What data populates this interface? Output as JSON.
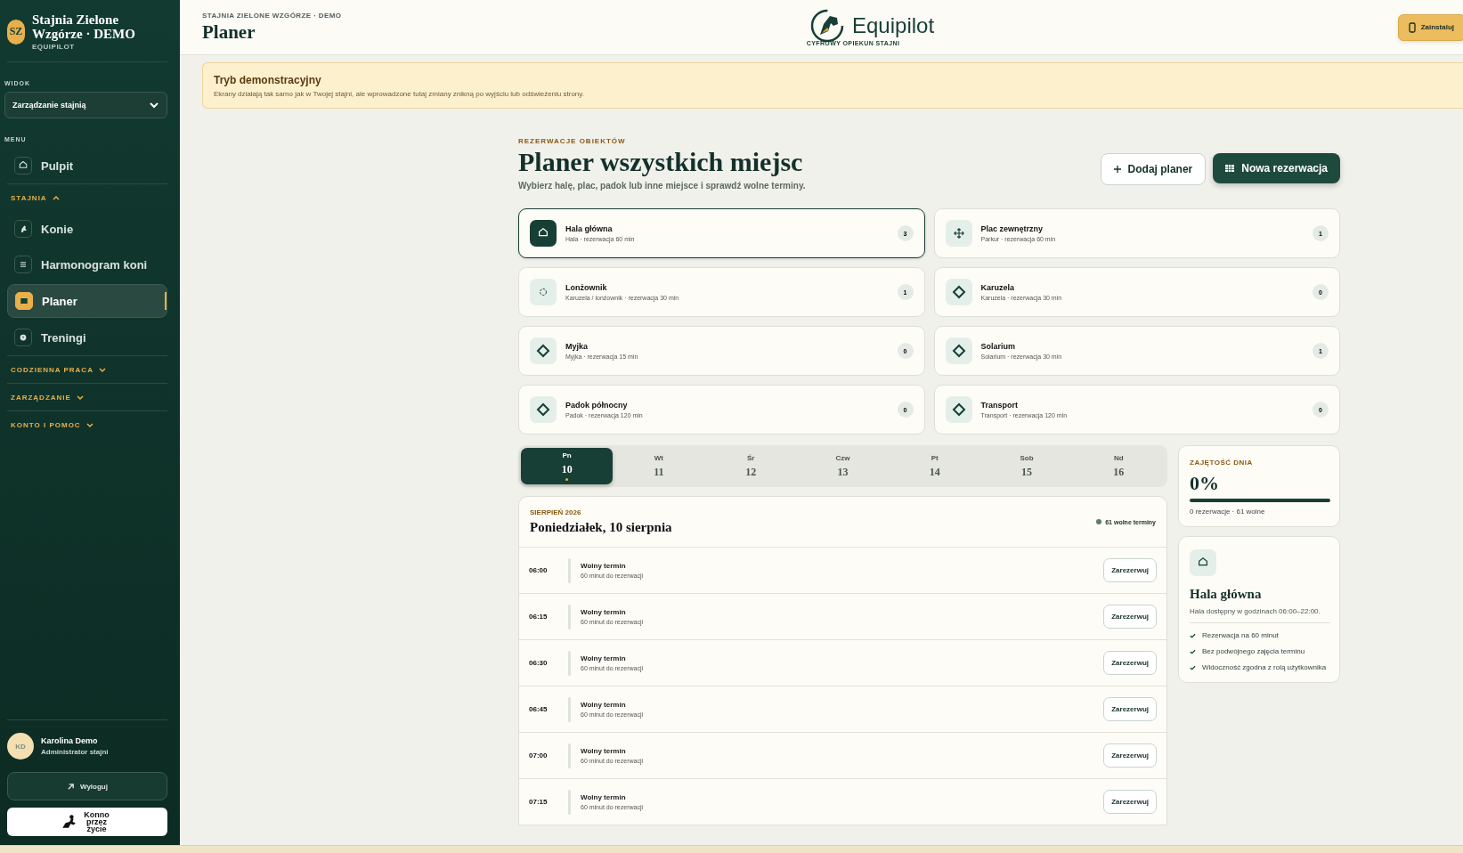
{
  "sidebar": {
    "initials": "SZ",
    "stable_name": "Stajnia Zielone Wzgórze · DEMO",
    "brand": "EQUIPILOT",
    "view_label": "WIDOK",
    "view_select": "Zarządzanie stajnią",
    "menu_label": "MENU",
    "menu": [
      {
        "kind": "link",
        "label": "Pulpit",
        "selected": false
      },
      {
        "kind": "group",
        "label": "STAJNIA",
        "expanded": true,
        "children": [
          {
            "kind": "link",
            "label": "Konie",
            "selected": false
          },
          {
            "kind": "link",
            "label": "Harmonogram koni",
            "selected": false
          },
          {
            "kind": "link",
            "label": "Planer",
            "selected": true
          },
          {
            "kind": "link",
            "label": "Treningi",
            "selected": false
          }
        ]
      },
      {
        "kind": "group",
        "label": "CODZIENNA PRACA",
        "expanded": false
      },
      {
        "kind": "group",
        "label": "ZARZĄDZANIE",
        "expanded": false
      },
      {
        "kind": "group",
        "label": "KONTO I POMOC",
        "expanded": false
      }
    ],
    "user": {
      "initials": "KD",
      "name": "Karolina Demo",
      "role": "Administrator stajni"
    },
    "logout": "Wyloguj",
    "partner": "Konno przez życie"
  },
  "header": {
    "breadcrumb": "STAJNIA ZIELONE WZGÓRZE · DEMO",
    "title": "Planer",
    "brand": "Equipilot",
    "tagline": "CYFROWY OPIEKUN STAJNI",
    "install": "Zainstaluj"
  },
  "banner": {
    "title": "Tryb demonstracyjny",
    "text": "Ekrany działają tak samo jak w Twojej stajni, ale wprowadzone tutaj zmiany znikną po wyjściu lub odświeżeniu strony."
  },
  "planner": {
    "eyebrow": "REZERWACJE OBIEKTÓW",
    "title": "Planer wszystkich miejsc",
    "subtitle": "Wybierz halę, plac, padok lub inne miejsce i sprawdź wolne terminy.",
    "add_button": "Dodaj planer",
    "new_button": "Nowa rezerwacja"
  },
  "facilities": [
    {
      "name": "Hala główna",
      "detail": "Hala · rezerwacja 60 min",
      "count": "3",
      "selected": true
    },
    {
      "name": "Plac zewnętrzny",
      "detail": "Parkur · rezerwacja 60 min",
      "count": "1",
      "selected": false
    },
    {
      "name": "Lonżownik",
      "detail": "Karuzela / lonżownik · rezerwacja 30 min",
      "count": "1",
      "selected": false
    },
    {
      "name": "Karuzela",
      "detail": "Karuzela · rezerwacja 30 min",
      "count": "0",
      "selected": false
    },
    {
      "name": "Myjka",
      "detail": "Myjka · rezerwacja 15 min",
      "count": "0",
      "selected": false
    },
    {
      "name": "Solarium",
      "detail": "Solarium · rezerwacja 30 min",
      "count": "1",
      "selected": false
    },
    {
      "name": "Padok północny",
      "detail": "Padok · rezerwacja 120 min",
      "count": "0",
      "selected": false
    },
    {
      "name": "Transport",
      "detail": "Transport · rezerwacja 120 min",
      "count": "0",
      "selected": false
    }
  ],
  "days": [
    {
      "weekday": "Pn",
      "day": "10",
      "selected": true
    },
    {
      "weekday": "Wt",
      "day": "11",
      "selected": false
    },
    {
      "weekday": "Śr",
      "day": "12",
      "selected": false
    },
    {
      "weekday": "Czw",
      "day": "13",
      "selected": false
    },
    {
      "weekday": "Pt",
      "day": "14",
      "selected": false
    },
    {
      "weekday": "Sob",
      "day": "15",
      "selected": false
    },
    {
      "weekday": "Nd",
      "day": "16",
      "selected": false
    }
  ],
  "schedule": {
    "month": "SIERPIEŃ 2026",
    "date": "Poniedziałek, 10 sierpnia",
    "free": "61 wolne terminy",
    "slots": [
      {
        "time": "06:00",
        "title": "Wolny termin",
        "detail": "60 minut do rezerwacji",
        "action": "Zarezerwuj"
      },
      {
        "time": "06:15",
        "title": "Wolny termin",
        "detail": "60 minut do rezerwacji",
        "action": "Zarezerwuj"
      },
      {
        "time": "06:30",
        "title": "Wolny termin",
        "detail": "60 minut do rezerwacji",
        "action": "Zarezerwuj"
      },
      {
        "time": "06:45",
        "title": "Wolny termin",
        "detail": "60 minut do rezerwacji",
        "action": "Zarezerwuj"
      },
      {
        "time": "07:00",
        "title": "Wolny termin",
        "detail": "60 minut do rezerwacji",
        "action": "Zarezerwuj"
      },
      {
        "time": "07:15",
        "title": "Wolny termin",
        "detail": "60 minut do rezerwacji",
        "action": "Zarezerwuj"
      }
    ]
  },
  "occupancy": {
    "label": "ZAJĘTOŚĆ DNIA",
    "value": "0%",
    "level": 0,
    "summary": "0 rezerwacje · 61 wolne"
  },
  "info": {
    "title": "Hala główna",
    "text": "Hala dostępny w godzinach 06:00–22:00.",
    "features": [
      "Rezerwacja na 60 minut",
      "Bez podwójnego zajęcia terminu",
      "Widoczność zgodna z rolą użytkownika"
    ]
  }
}
